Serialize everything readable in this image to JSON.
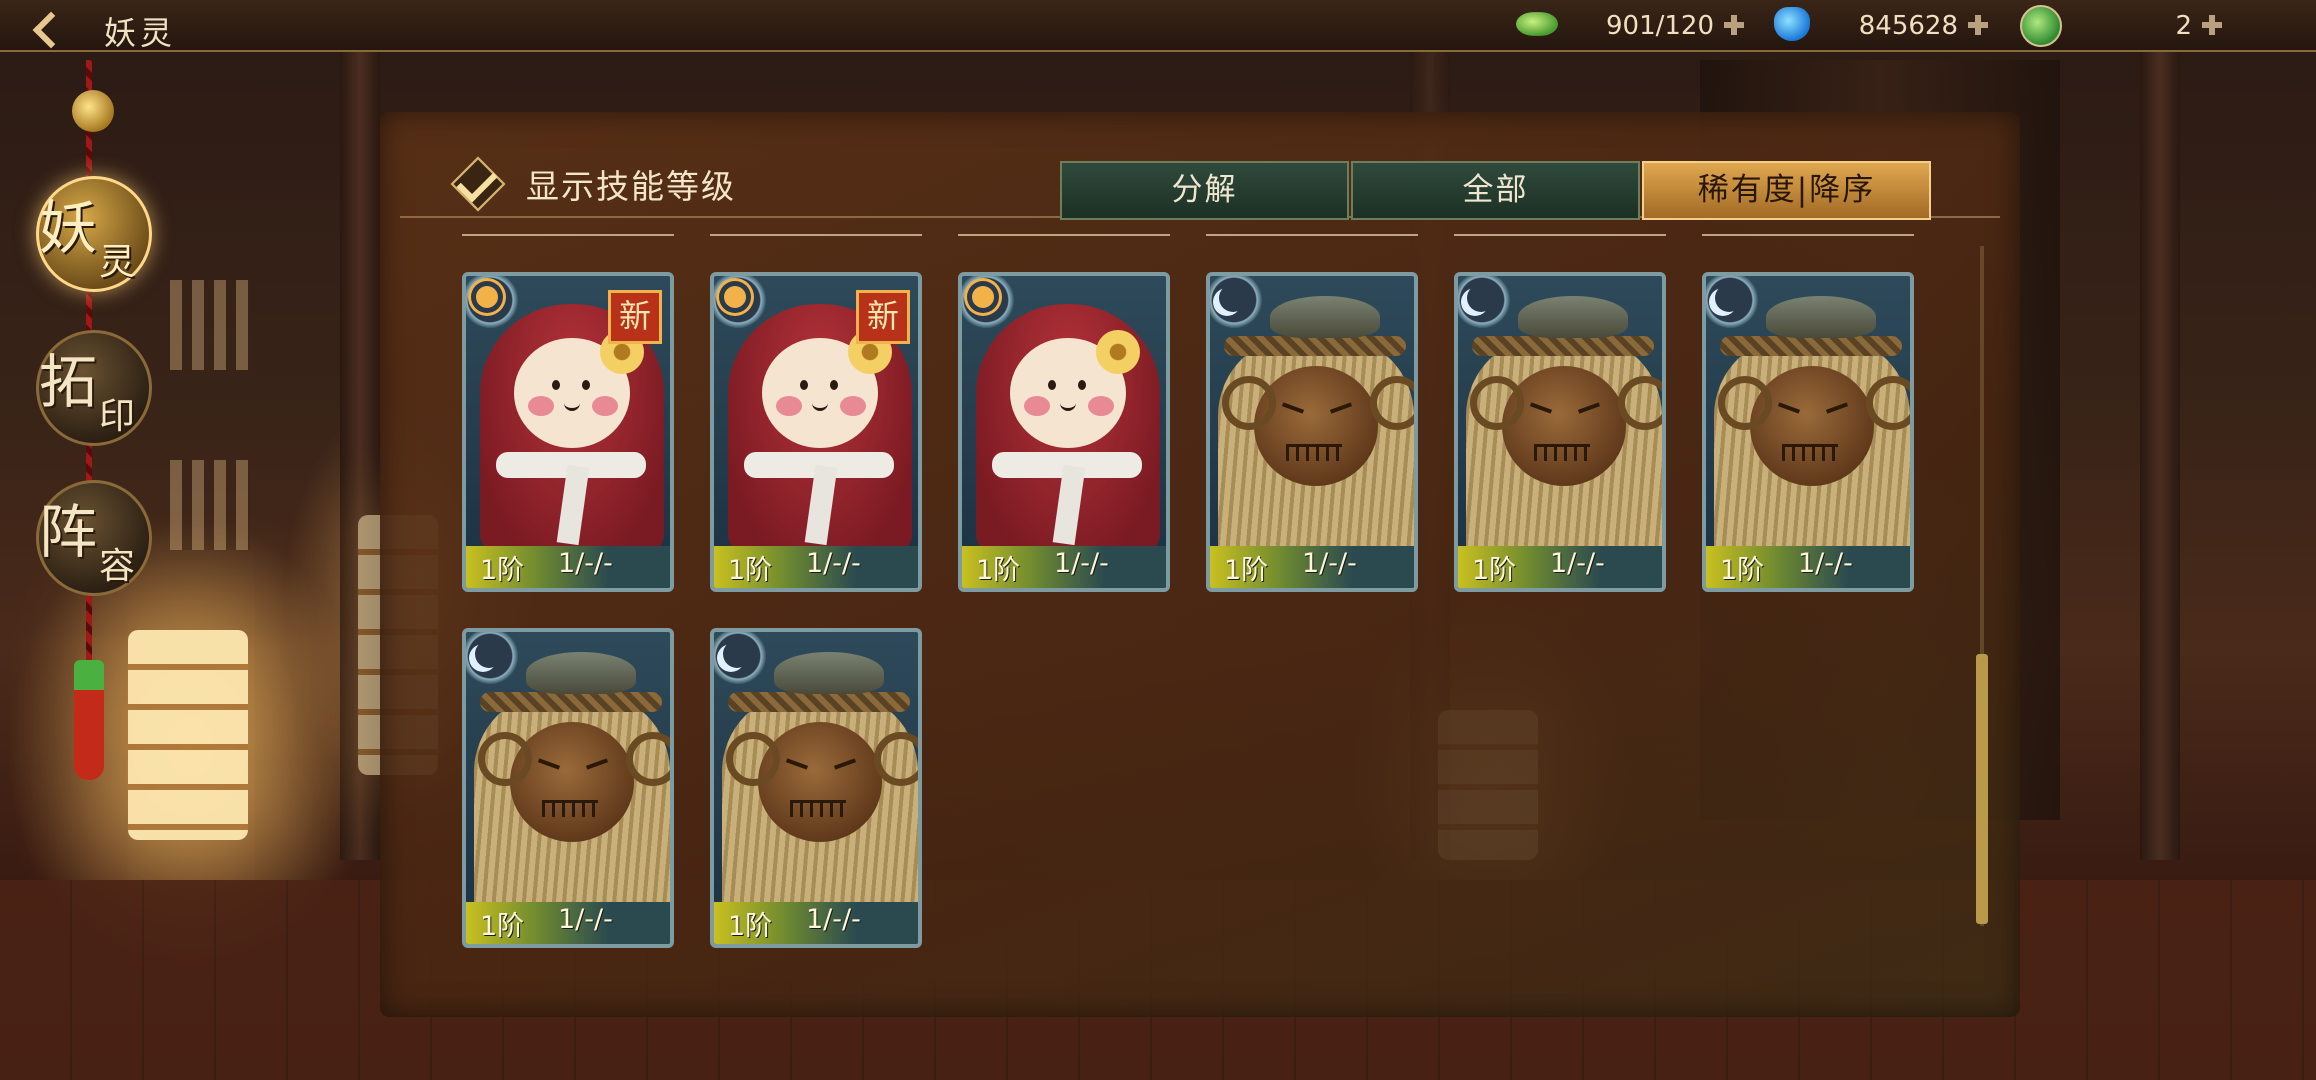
{
  "header": {
    "title": "妖灵",
    "resources": [
      {
        "icon": "jade-icon",
        "value": "901/120"
      },
      {
        "icon": "potion-icon",
        "value": "845628"
      },
      {
        "icon": "leaf-icon",
        "value": "2"
      }
    ]
  },
  "sidebar": {
    "tabs": [
      {
        "big": "妖",
        "small": "灵",
        "active": true
      },
      {
        "big": "拓",
        "small": "印",
        "active": false
      },
      {
        "big": "阵",
        "small": "容",
        "active": false
      }
    ]
  },
  "panel": {
    "show_skill_label": "显示技能等级",
    "show_skill_checked": true,
    "tabs": [
      {
        "label": "分解",
        "active": false
      },
      {
        "label": "全部",
        "active": false
      },
      {
        "label": "稀有度|降序",
        "active": true
      }
    ]
  },
  "cards": [
    {
      "type": "red-doll",
      "element": "sun-icon",
      "new_badge": "新",
      "level": "1阶",
      "skills": "1/-/-"
    },
    {
      "type": "red-doll",
      "element": "sun-icon",
      "new_badge": "新",
      "level": "1阶",
      "skills": "1/-/-"
    },
    {
      "type": "red-doll",
      "element": "sun-icon",
      "new_badge": "",
      "level": "1阶",
      "skills": "1/-/-"
    },
    {
      "type": "straw-creature",
      "element": "moon-icon",
      "new_badge": "",
      "level": "1阶",
      "skills": "1/-/-"
    },
    {
      "type": "straw-creature",
      "element": "moon-icon",
      "new_badge": "",
      "level": "1阶",
      "skills": "1/-/-"
    },
    {
      "type": "straw-creature",
      "element": "moon-icon",
      "new_badge": "",
      "level": "1阶",
      "skills": "1/-/-"
    },
    {
      "type": "straw-creature",
      "element": "moon-icon",
      "new_badge": "",
      "level": "1阶",
      "skills": "1/-/-"
    },
    {
      "type": "straw-creature",
      "element": "moon-icon",
      "new_badge": "",
      "level": "1阶",
      "skills": "1/-/-"
    }
  ],
  "colors": {
    "active_tab": "#c08a3a",
    "inactive_tab": "#23392c",
    "card_border": "#7d9ba0"
  }
}
